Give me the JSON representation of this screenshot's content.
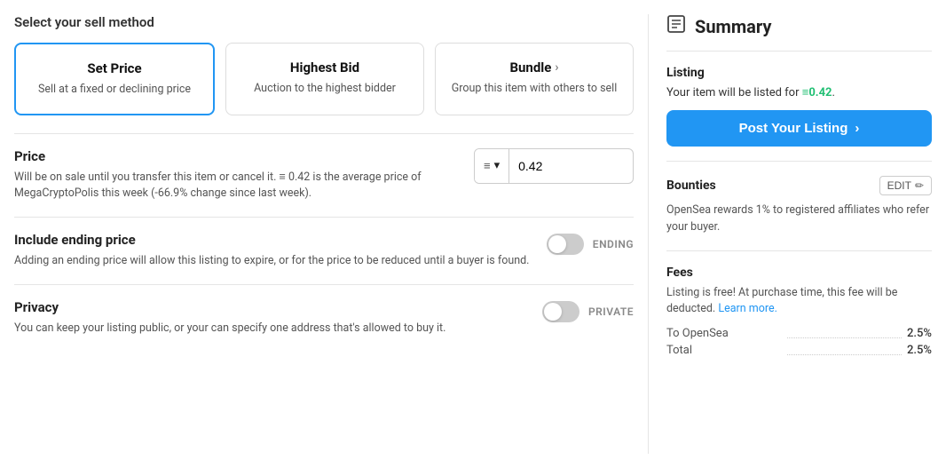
{
  "page": {
    "title": "Select your sell method"
  },
  "sell_methods": [
    {
      "id": "set_price",
      "title": "Set Price",
      "desc": "Sell at a fixed or declining price",
      "active": true,
      "has_arrow": false
    },
    {
      "id": "highest_bid",
      "title": "Highest Bid",
      "desc": "Auction to the highest bidder",
      "active": false,
      "has_arrow": false
    },
    {
      "id": "bundle",
      "title": "Bundle",
      "desc": "Group this item with others to sell",
      "active": false,
      "has_arrow": true
    }
  ],
  "price_section": {
    "title": "Price",
    "desc": "Will be on sale until you transfer this item or cancel it. ≡ 0.42 is the average price of MegaCryptoPolis this week (-66.9% change since last week).",
    "currency_symbol": "≡",
    "currency_dropdown": "▾",
    "value": "0.42"
  },
  "ending_section": {
    "title": "Include ending price",
    "desc": "Adding an ending price will allow this listing to expire, or for the price to be reduced until a buyer is found.",
    "label": "ENDING",
    "enabled": false
  },
  "privacy_section": {
    "title": "Privacy",
    "desc": "You can keep your listing public, or your can specify one address that's allowed to buy it.",
    "label": "PRIVATE",
    "enabled": false
  },
  "summary": {
    "title": "Summary",
    "icon": "≡",
    "listing": {
      "label": "Listing",
      "price_text": "Your item will be listed for",
      "price_value": "≡0.42",
      "price_suffix": "."
    },
    "post_button": "Post Your Listing",
    "bounties": {
      "label": "Bounties",
      "edit_label": "EDIT",
      "desc": "OpenSea rewards 1% to registered affiliates who refer your buyer."
    },
    "fees": {
      "label": "Fees",
      "desc_part1": "Listing is free! At purchase time, this fee will be deducted.",
      "learn_more": "Learn more.",
      "rows": [
        {
          "name": "To OpenSea",
          "value": "2.5%"
        },
        {
          "name": "Total",
          "value": "2.5%"
        }
      ]
    }
  }
}
